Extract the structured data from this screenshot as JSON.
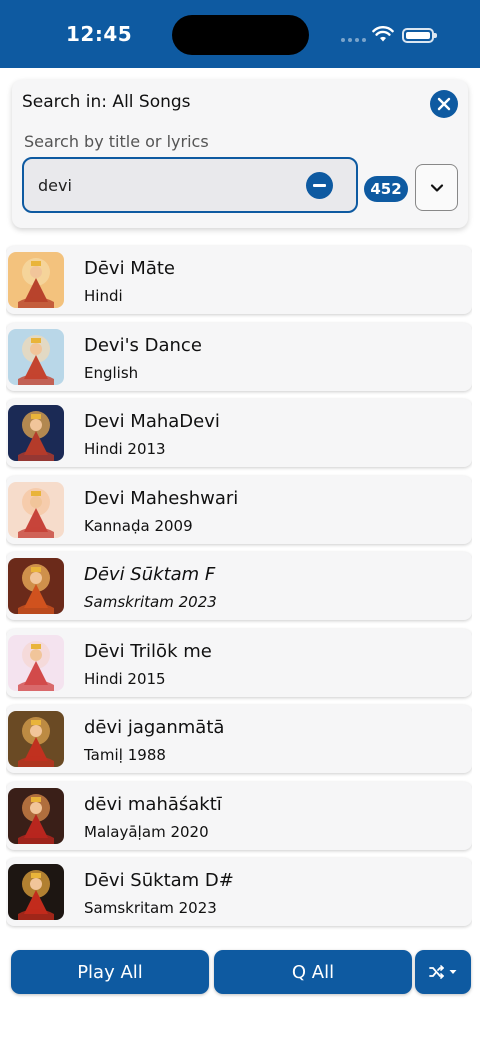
{
  "status_bar": {
    "time": "12:45"
  },
  "search": {
    "title": "Search in: All Songs",
    "hint": "Search by title or lyrics",
    "value": "devi",
    "result_count": "452"
  },
  "songs": [
    {
      "title": "Dēvi Māte",
      "subtitle": "Hindi",
      "italic": false,
      "art": [
        "#f3c27d",
        "#b8432c",
        "#f6d9a4"
      ]
    },
    {
      "title": "Devi's Dance",
      "subtitle": "English",
      "italic": false,
      "art": [
        "#b9d7e8",
        "#c4442f",
        "#f0d9b8"
      ]
    },
    {
      "title": "Devi MahaDevi",
      "subtitle": "Hindi 2013",
      "italic": false,
      "art": [
        "#1b2a55",
        "#b43b2a",
        "#e6a84f"
      ]
    },
    {
      "title": "Devi Maheshwari",
      "subtitle": "Kannaḍa 2009",
      "italic": false,
      "art": [
        "#f6dccb",
        "#c7443a",
        "#f5c7a1"
      ]
    },
    {
      "title": "Dēvi Sūktam F",
      "subtitle": "Samskritam 2023",
      "italic": true,
      "art": [
        "#6b2a1a",
        "#d0521e",
        "#f0b35c"
      ]
    },
    {
      "title": "Dēvi Trilōk me",
      "subtitle": "Hindi 2015",
      "italic": false,
      "art": [
        "#f4e3ef",
        "#d24a4a",
        "#f6d7d3"
      ]
    },
    {
      "title": "dēvi jaganmātā",
      "subtitle": "Tamiḷ 1988",
      "italic": false,
      "art": [
        "#6a4a24",
        "#c1311f",
        "#d9a24d"
      ]
    },
    {
      "title": "dēvi mahāśaktī",
      "subtitle": "Malayāḷam 2020",
      "italic": false,
      "art": [
        "#3a1f18",
        "#b8261e",
        "#d88a4a"
      ]
    },
    {
      "title": "Dēvi Sūktam D#",
      "subtitle": "Samskritam 2023",
      "italic": false,
      "art": [
        "#1d1612",
        "#c22b1c",
        "#e3a43c"
      ]
    }
  ],
  "actions": {
    "play_all": "Play All",
    "queue_all": "Q All"
  },
  "colors": {
    "accent": "#0e5aa1",
    "row_bg": "#f6f6f7"
  },
  "icons": {
    "close": "close-icon",
    "clear": "minus-circle-icon",
    "dropdown": "chevron-down-icon",
    "shuffle": "shuffle-icon",
    "wifi": "wifi-icon",
    "battery": "battery-icon"
  }
}
